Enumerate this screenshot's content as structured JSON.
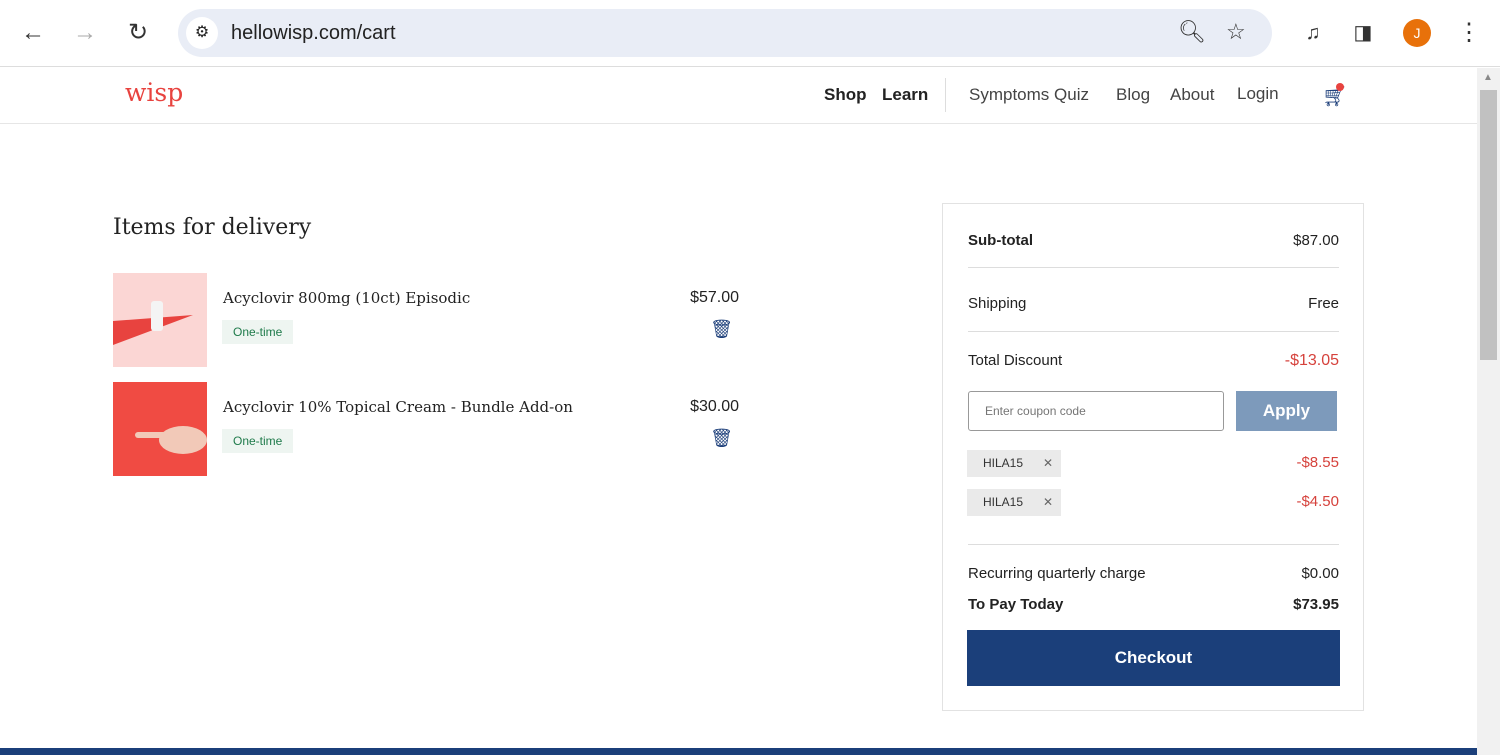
{
  "browser": {
    "url": "hellowisp.com/cart",
    "avatar_letter": "J"
  },
  "header": {
    "logo": "wisp",
    "nav": [
      "Shop",
      "Learn",
      "Symptoms Quiz",
      "Blog",
      "About",
      "Login"
    ]
  },
  "cart": {
    "title": "Items for delivery",
    "items": [
      {
        "name": "Acyclovir 800mg (10ct) Episodic",
        "badge": "One-time",
        "price": "$57.00"
      },
      {
        "name": "Acyclovir 10% Topical Cream - Bundle Add-on",
        "badge": "One-time",
        "price": "$30.00"
      }
    ]
  },
  "summary": {
    "subtotal_label": "Sub-total",
    "subtotal": "$87.00",
    "shipping_label": "Shipping",
    "shipping": "Free",
    "discount_label": "Total Discount",
    "discount": "-$13.05",
    "coupon_placeholder": "Enter coupon code",
    "apply": "Apply",
    "coupons": [
      {
        "code": "HILA15",
        "amount": "-$8.55"
      },
      {
        "code": "HILA15",
        "amount": "-$4.50"
      }
    ],
    "recurring_label": "Recurring quarterly charge",
    "recurring": "$0.00",
    "pay_label": "To Pay Today",
    "pay": "$73.95",
    "checkout": "Checkout"
  },
  "colors": {
    "brand": "#e8433f",
    "navy": "#1b3f7a",
    "discount": "#d6423c"
  }
}
